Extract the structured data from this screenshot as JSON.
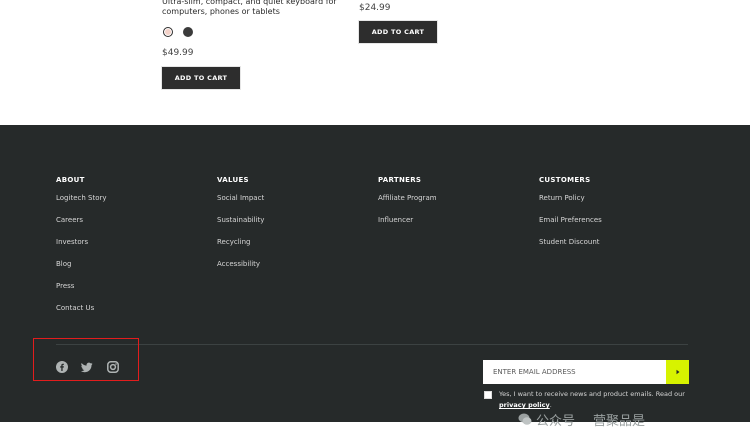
{
  "products": [
    {
      "description": "Ultra-slim, compact, and quiet keyboard for computers, phones or tablets",
      "colors": [
        "#f4d2c9",
        "#3b3b3b"
      ],
      "price": "$49.99",
      "button": "ADD TO CART"
    },
    {
      "price": "$24.99",
      "button": "ADD TO CART"
    }
  ],
  "footer": {
    "columns": [
      {
        "title": "ABOUT",
        "links": [
          "Logitech Story",
          "Careers",
          "Investors",
          "Blog",
          "Press",
          "Contact Us"
        ]
      },
      {
        "title": "VALUES",
        "links": [
          "Social Impact",
          "Sustainability",
          "Recycling",
          "Accessibility"
        ]
      },
      {
        "title": "PARTNERS",
        "links": [
          "Affiliate Program",
          "Influencer"
        ]
      },
      {
        "title": "CUSTOMERS",
        "links": [
          "Return Policy",
          "Email Preferences",
          "Student Discount"
        ]
      }
    ],
    "social": [
      "facebook-icon",
      "twitter-icon",
      "instagram-icon"
    ],
    "email_placeholder": "ENTER EMAIL ADDRESS",
    "consent_text": "Yes, I want to receive news and product emails. Read our",
    "privacy_link": "privacy policy",
    "consent_end": "."
  },
  "watermark": {
    "left": "公众号",
    "right": "营聚品是"
  },
  "colors": {
    "footer_bg": "#262a2a",
    "accent": "#d7f300",
    "highlight": "#e21d1d",
    "button_bg": "#2d2d2d"
  }
}
